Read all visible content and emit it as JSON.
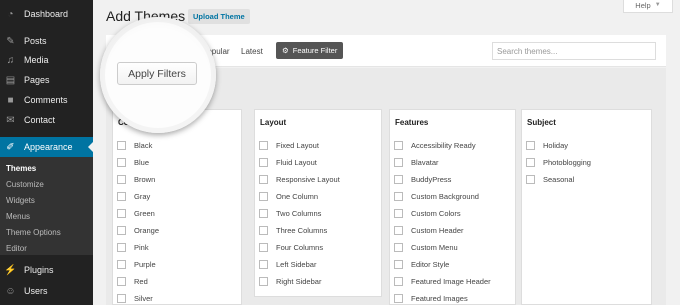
{
  "sidebar": {
    "items": [
      {
        "label": "Dashboard",
        "icon": "dashboard-icon"
      },
      {
        "label": "Posts",
        "icon": "pin-icon"
      },
      {
        "label": "Media",
        "icon": "media-icon"
      },
      {
        "label": "Pages",
        "icon": "pages-icon"
      },
      {
        "label": "Comments",
        "icon": "comments-icon"
      },
      {
        "label": "Contact",
        "icon": "mail-icon"
      },
      {
        "label": "Appearance",
        "icon": "brush-icon"
      },
      {
        "label": "Plugins",
        "icon": "plug-icon"
      },
      {
        "label": "Users",
        "icon": "users-icon"
      }
    ],
    "submenu": [
      "Themes",
      "Customize",
      "Widgets",
      "Menus",
      "Theme Options",
      "Editor"
    ]
  },
  "header": {
    "title": "Add Themes",
    "upload_label": "Upload Theme",
    "help_label": "Help"
  },
  "filter_bar": {
    "popular": "Popular",
    "latest": "Latest",
    "feature_filter": "Feature Filter",
    "search_placeholder": "Search themes..."
  },
  "apply_filters_label": "Apply Filters",
  "groups": [
    {
      "title": "Colors",
      "options": [
        "Black",
        "Blue",
        "Brown",
        "Gray",
        "Green",
        "Orange",
        "Pink",
        "Purple",
        "Red",
        "Silver"
      ]
    },
    {
      "title": "Layout",
      "options": [
        "Fixed Layout",
        "Fluid Layout",
        "Responsive Layout",
        "One Column",
        "Two Columns",
        "Three Columns",
        "Four Columns",
        "Left Sidebar",
        "Right Sidebar"
      ]
    },
    {
      "title": "Features",
      "options": [
        "Accessibility Ready",
        "Blavatar",
        "BuddyPress",
        "Custom Background",
        "Custom Colors",
        "Custom Header",
        "Custom Menu",
        "Editor Style",
        "Featured Image Header",
        "Featured Images"
      ]
    },
    {
      "title": "Subject",
      "options": [
        "Holiday",
        "Photoblogging",
        "Seasonal"
      ]
    }
  ],
  "colors": {
    "sidebar_bg": "#222222",
    "active_blue": "#0074a2",
    "submenu_bg": "#333333"
  }
}
